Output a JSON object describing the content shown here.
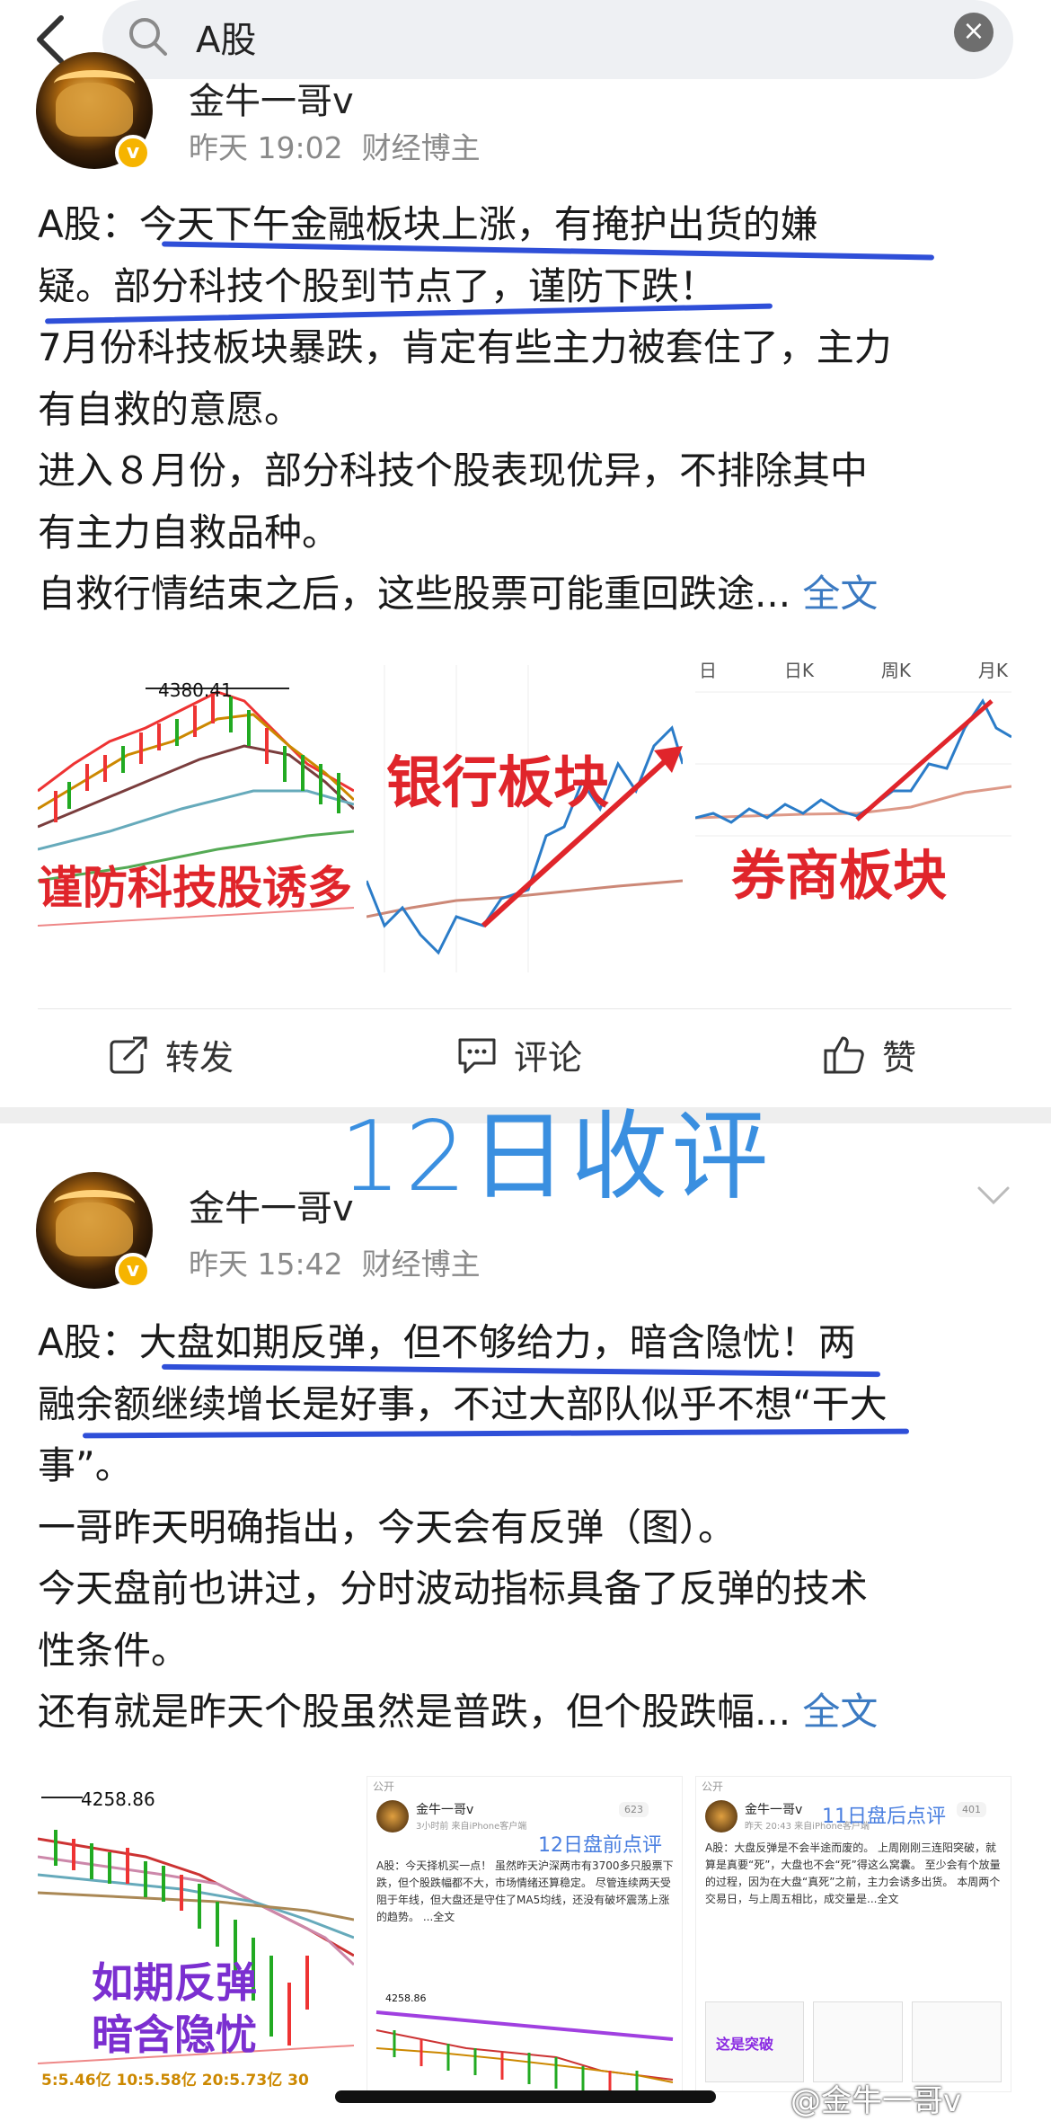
{
  "search": {
    "query": "A股",
    "clear_glyph": "×"
  },
  "post1": {
    "author": "金牛一哥v",
    "time": "昨天 19:02",
    "source": "财经博主",
    "lines": [
      "A股：今天下午金融板块上涨，有掩护出货的嫌",
      "疑。部分科技个股到节点了，谨防下跌！",
      "7月份科技板块暴跌，肯定有些主力被套住了，主力",
      "有自救的意愿。",
      "进入８月份，部分科技个股表现优异，不排除其中",
      "有主力自救品种。",
      "自救行情结束之后，这些股票可能重回跌途..."
    ],
    "more": "全文",
    "images": {
      "img1": {
        "price": "4380.41",
        "caption": "谨防科技股诱多"
      },
      "img2": {
        "caption": "银行板块"
      },
      "img3": {
        "tabs": [
          "日",
          "日K",
          "周K",
          "月K"
        ],
        "caption": "券商板块"
      }
    },
    "actions": {
      "repost": "转发",
      "comment": "评论",
      "like": "赞"
    }
  },
  "overlay_title": "12日收评",
  "post2": {
    "author": "金牛一哥v",
    "time": "昨天 15:42",
    "source": "财经博主",
    "lines": [
      "A股：大盘如期反弹，但不够给力，暗含隐忧！两",
      "融余额继续增长是好事，不过大部队似乎不想“干大",
      "事”。",
      "一哥昨天明确指出，今天会有反弹（图）。",
      "今天盘前也讲过，分时波动指标具备了反弹的技术",
      "性条件。",
      "还有就是昨天个股虽然是普跌，但个股跌幅..."
    ],
    "more": "全文",
    "images": {
      "img1": {
        "price": "4258.86",
        "caption1": "如期反弹",
        "caption2": "暗含隐忧",
        "bottom": "5:5.46亿  10:5.58亿  20:5.73亿  30"
      },
      "img2": {
        "public": "公开",
        "author": "金牛一哥v",
        "meta": "3小时前 来自iPhone客户端",
        "badge": "623",
        "title": "12日盘前点评",
        "text": "A股：今天择机买一点！ 虽然昨天沪深两市有3700多只股票下跌，但个股跌幅都不大，市场情绪还算稳定。 尽管连续两天受阻于年线，但大盘还是守住了MA5均线，还没有破坏震荡上涨的趋势。 ...全文",
        "price": "4258.86"
      },
      "img3": {
        "public": "公开",
        "author": "金牛一哥v",
        "meta": "昨天 20:43 来自iPhone客户端",
        "badge": "401",
        "title": "11日盘后点评",
        "text": "A股：大盘反弹是不会半途而废的。 上周刚刚三连阳突破，就算是真要“死”，大盘也不会“死”得这么窝囊。 至少会有个放量的过程，因为在大盘“真死”之前，主力会诱多出货。 本周两个交易日，与上周五相比，成交量是...全文",
        "caption": "这是突破"
      }
    },
    "watermark": "@金牛一哥v"
  },
  "colors": {
    "link": "#3b7ac2",
    "underline": "#2f4fd8",
    "overlay": "#3a8fe0",
    "red": "#e0252b",
    "verified": "#f6b400"
  }
}
